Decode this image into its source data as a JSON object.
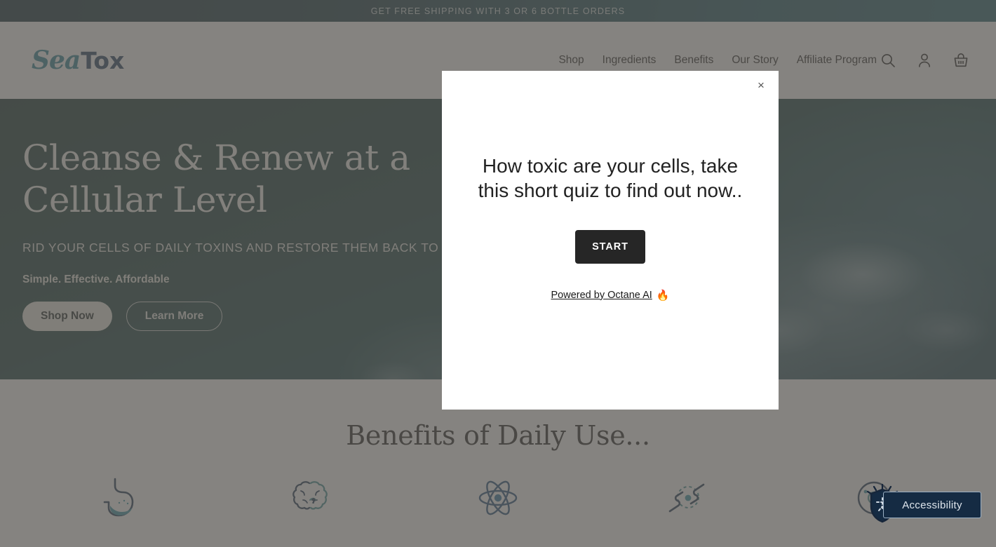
{
  "promo_banner": {
    "text": "GET FREE SHIPPING WITH 3 OR 6 BOTTLE ORDERS"
  },
  "header": {
    "logo": {
      "part1": "Sea",
      "part2": "Tox"
    },
    "nav": [
      {
        "label": "Shop"
      },
      {
        "label": "Ingredients"
      },
      {
        "label": "Benefits"
      },
      {
        "label": "Our Story"
      },
      {
        "label": "Affiliate Program"
      }
    ],
    "icons": [
      {
        "name": "search-icon"
      },
      {
        "name": "account-icon"
      },
      {
        "name": "cart-icon"
      }
    ]
  },
  "hero": {
    "title_line1": "Cleanse & Renew at a",
    "title_line2": "Cellular Level",
    "subtitle": "RID YOUR CELLS OF DAILY TOXINS AND RESTORE THEM BACK TO HEALTH",
    "tagline": "Simple. Effective. Affordable",
    "primary_button": "Shop Now",
    "secondary_button": "Learn More"
  },
  "benefits": {
    "title": "Benefits of Daily Use...",
    "items": [
      {
        "icon": "stomach-icon"
      },
      {
        "icon": "brain-icon"
      },
      {
        "icon": "atom-icon"
      },
      {
        "icon": "molecule-icon"
      },
      {
        "icon": "cell-icon"
      }
    ]
  },
  "quiz_modal": {
    "close_label": "×",
    "headline": "How toxic are your cells, take this short quiz to find out now..",
    "start_button": "START",
    "powered_by": "Powered by Octane AI",
    "powered_emoji": "🔥"
  },
  "accessibility_widget": {
    "label": "Accessibility"
  },
  "colors": {
    "banner_teal": "#0b2f3a",
    "logo_sea": "#2a7f92",
    "logo_tox": "#1b3a5c",
    "hero_dark_teal": "#0b302f",
    "start_button": "#262626",
    "accessibility_navy": "#152b43",
    "flame_orange": "#f07b21"
  }
}
